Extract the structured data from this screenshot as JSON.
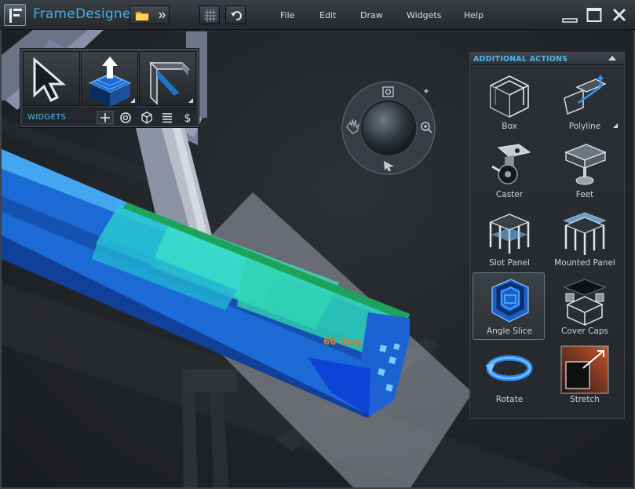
{
  "app": {
    "title": "FrameDesigner"
  },
  "menu": [
    {
      "label": "File"
    },
    {
      "label": "Edit"
    },
    {
      "label": "Draw"
    },
    {
      "label": "Widgets"
    },
    {
      "label": "Help"
    }
  ],
  "widgets_panel": {
    "label": "WIDGETS",
    "tiles": [
      "select-arrow-icon",
      "extrude-frame-icon",
      "bracket-profile-icon"
    ],
    "toolbar_icons": [
      "add-icon",
      "settings-gear-icon",
      "cube-icon",
      "list-icon",
      "dollar-icon"
    ]
  },
  "viewport": {
    "angle_annotation": "60 deg."
  },
  "actions_panel": {
    "title": "ADDITIONAL ACTIONS",
    "items": [
      {
        "label": "Box",
        "icon": "box-frame-icon"
      },
      {
        "label": "Polyline",
        "icon": "polyline-icon"
      },
      {
        "label": "Caster",
        "icon": "caster-icon"
      },
      {
        "label": "Feet",
        "icon": "feet-icon"
      },
      {
        "label": "Slot Panel",
        "icon": "slot-panel-icon"
      },
      {
        "label": "Mounted Panel",
        "icon": "mounted-panel-icon"
      },
      {
        "label": "Angle Slice",
        "icon": "angle-slice-icon",
        "selected": true
      },
      {
        "label": "Cover Caps",
        "icon": "cover-caps-icon"
      },
      {
        "label": "Rotate",
        "icon": "rotate-icon"
      },
      {
        "label": "Stretch",
        "icon": "stretch-icon"
      }
    ]
  },
  "colors": {
    "accent": "#3fb0ea",
    "profile_blue": "#1e6fe0",
    "profile_cyan": "#2fd0c8",
    "annotation": "#e07a1c"
  }
}
